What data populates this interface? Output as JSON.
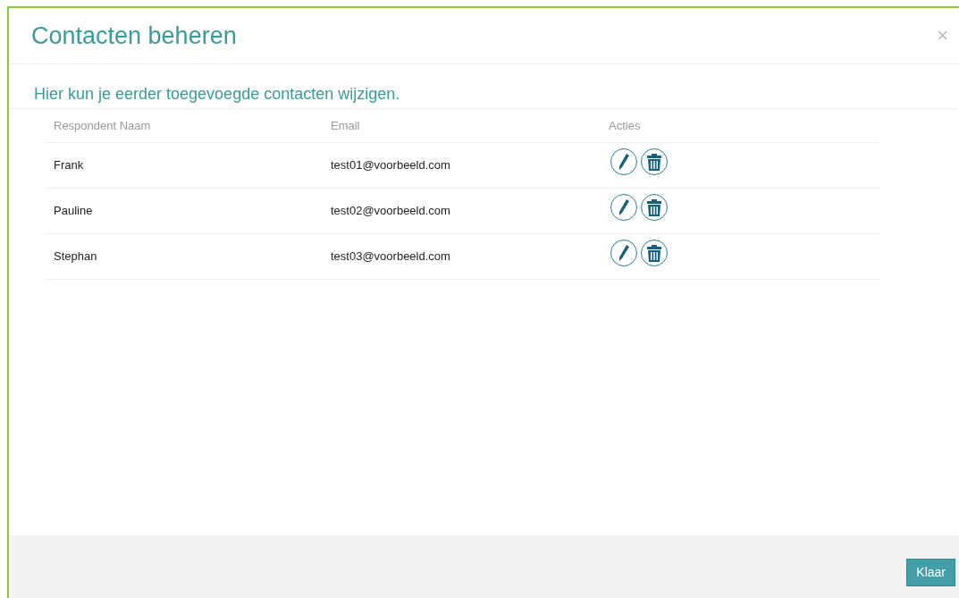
{
  "dialog": {
    "title": "Contacten beheren",
    "close": "×",
    "subtitle": "Hier kun je eerder toegevoegde contacten wijzigen.",
    "table": {
      "columns": [
        "Respondent Naam",
        "Email",
        "Acties"
      ],
      "rows": [
        {
          "name": "Frank",
          "email": "test01@voorbeeld.com"
        },
        {
          "name": "Pauline",
          "email": "test02@voorbeeld.com"
        },
        {
          "name": "Stephan",
          "email": "test03@voorbeeld.com"
        }
      ]
    },
    "footer": {
      "button": "Klaar"
    }
  }
}
